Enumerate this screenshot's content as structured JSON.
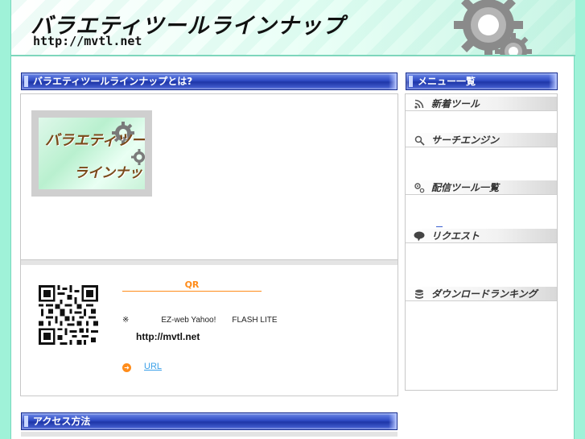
{
  "header": {
    "title": "バラエティツールラインナップ",
    "url": "http://mvtl.net"
  },
  "main": {
    "about": {
      "heading": "バラエティツールラインナップとは?",
      "logo": {
        "line1": "バラエティツール",
        "line2": "ラインナップ"
      }
    },
    "qr_section": {
      "title": "QR",
      "note": "※　　　　EZ-web  Yahoo!　　FLASH LITE",
      "url": "http://mvtl.net",
      "link_label": "URL"
    },
    "access": {
      "heading": "アクセス方法"
    }
  },
  "sidebar": {
    "heading": "メニュー一覧",
    "items": [
      {
        "label": "新着ツール",
        "icon": "rss-icon"
      },
      {
        "label": "サーチエンジン",
        "icon": "search-icon"
      },
      {
        "label": "配信ツール一覧",
        "icon": "gear-icon"
      },
      {
        "label": "リクエスト",
        "icon": "speech-bubble-icon"
      },
      {
        "label": "ダウンロードランキング",
        "icon": "database-icon"
      }
    ],
    "dash_link": "—"
  },
  "colors": {
    "background": "#9ff2d8",
    "bar_blue": "#2f4bc4",
    "accent_orange": "#ff8c1a",
    "link_blue": "#3aa0e8"
  }
}
